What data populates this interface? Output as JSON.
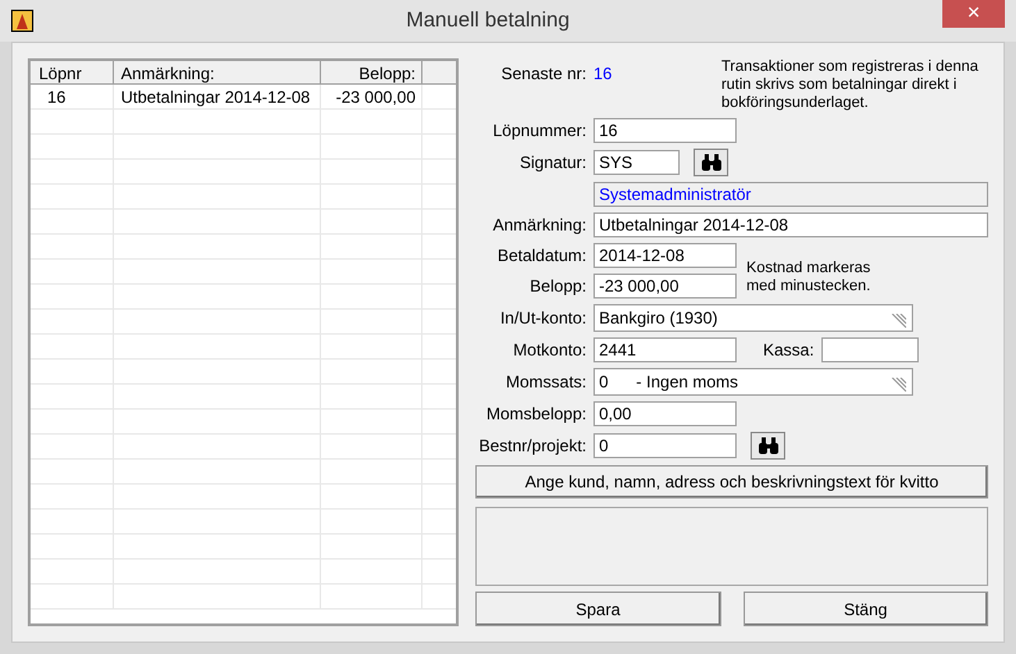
{
  "window": {
    "title": "Manuell betalning",
    "close": "×"
  },
  "list": {
    "columns": [
      "Löpnr",
      "Anmärkning:",
      "Belopp:"
    ],
    "rows": [
      {
        "cells": [
          "16",
          "Utbetalningar 2014-12-08",
          "-23 000,00"
        ],
        "selected": false
      }
    ]
  },
  "form": {
    "latest": {
      "label": "Senaste nr:",
      "value": "16"
    },
    "info": "Transaktioner som registreras i denna rutin skrivs som betalningar direkt i bokföringsunderlaget.",
    "serial": {
      "label": "Löpnummer:",
      "value": "16"
    },
    "signature": {
      "label": "Signatur:",
      "value": "SYS"
    },
    "signature_name": "Systemadministratör",
    "remark": {
      "label": "Anmärkning:",
      "value": "Utbetalningar 2014-12-08"
    },
    "date": {
      "label": "Betaldatum:",
      "value": "2014-12-08"
    },
    "amount": {
      "label": "Belopp:",
      "value": "-23 000,00"
    },
    "amount_note": "Kostnad markeras med minustecken.",
    "account": {
      "label": "In/Ut-konto:",
      "value": "Bankgiro (1930)"
    },
    "counter_account": {
      "label": "Motkonto:",
      "value": "2441"
    },
    "cash": {
      "label": "Kassa:"
    },
    "vat_rate": {
      "label": "Momssats:",
      "value": "0      - Ingen moms"
    },
    "vat_amount": {
      "label": "Momsbelopp:",
      "value": "0,00"
    },
    "project": {
      "label": "Bestnr/projekt:",
      "value": "0"
    },
    "receipt_button": "Ange kund, namn, adress och beskrivningstext för kvitto"
  },
  "buttons": [
    "Spara",
    "Stäng"
  ]
}
